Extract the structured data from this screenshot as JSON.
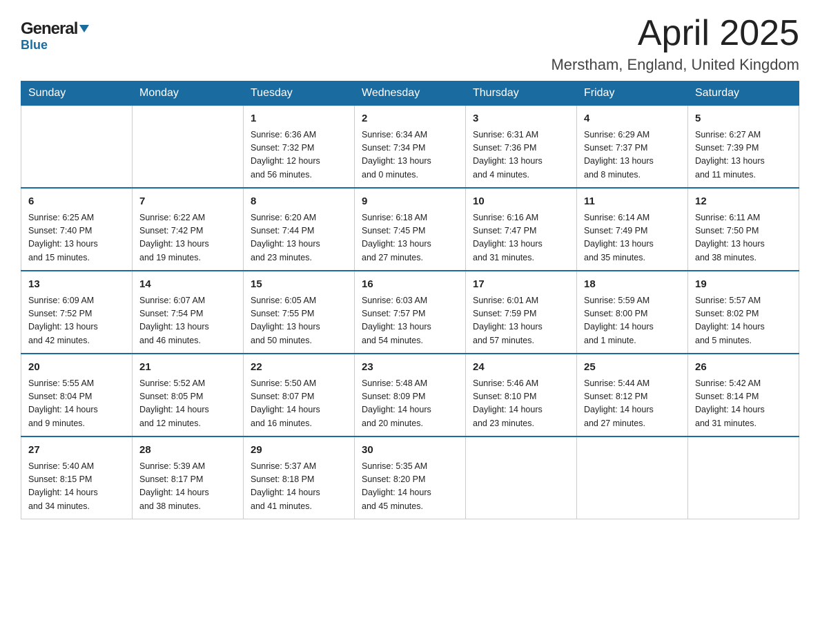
{
  "header": {
    "title": "April 2025",
    "subtitle": "Merstham, England, United Kingdom",
    "logo_general": "General",
    "logo_blue": "Blue"
  },
  "days_of_week": [
    "Sunday",
    "Monday",
    "Tuesday",
    "Wednesday",
    "Thursday",
    "Friday",
    "Saturday"
  ],
  "weeks": [
    [
      {
        "day": "",
        "info": ""
      },
      {
        "day": "",
        "info": ""
      },
      {
        "day": "1",
        "info": "Sunrise: 6:36 AM\nSunset: 7:32 PM\nDaylight: 12 hours\nand 56 minutes."
      },
      {
        "day": "2",
        "info": "Sunrise: 6:34 AM\nSunset: 7:34 PM\nDaylight: 13 hours\nand 0 minutes."
      },
      {
        "day": "3",
        "info": "Sunrise: 6:31 AM\nSunset: 7:36 PM\nDaylight: 13 hours\nand 4 minutes."
      },
      {
        "day": "4",
        "info": "Sunrise: 6:29 AM\nSunset: 7:37 PM\nDaylight: 13 hours\nand 8 minutes."
      },
      {
        "day": "5",
        "info": "Sunrise: 6:27 AM\nSunset: 7:39 PM\nDaylight: 13 hours\nand 11 minutes."
      }
    ],
    [
      {
        "day": "6",
        "info": "Sunrise: 6:25 AM\nSunset: 7:40 PM\nDaylight: 13 hours\nand 15 minutes."
      },
      {
        "day": "7",
        "info": "Sunrise: 6:22 AM\nSunset: 7:42 PM\nDaylight: 13 hours\nand 19 minutes."
      },
      {
        "day": "8",
        "info": "Sunrise: 6:20 AM\nSunset: 7:44 PM\nDaylight: 13 hours\nand 23 minutes."
      },
      {
        "day": "9",
        "info": "Sunrise: 6:18 AM\nSunset: 7:45 PM\nDaylight: 13 hours\nand 27 minutes."
      },
      {
        "day": "10",
        "info": "Sunrise: 6:16 AM\nSunset: 7:47 PM\nDaylight: 13 hours\nand 31 minutes."
      },
      {
        "day": "11",
        "info": "Sunrise: 6:14 AM\nSunset: 7:49 PM\nDaylight: 13 hours\nand 35 minutes."
      },
      {
        "day": "12",
        "info": "Sunrise: 6:11 AM\nSunset: 7:50 PM\nDaylight: 13 hours\nand 38 minutes."
      }
    ],
    [
      {
        "day": "13",
        "info": "Sunrise: 6:09 AM\nSunset: 7:52 PM\nDaylight: 13 hours\nand 42 minutes."
      },
      {
        "day": "14",
        "info": "Sunrise: 6:07 AM\nSunset: 7:54 PM\nDaylight: 13 hours\nand 46 minutes."
      },
      {
        "day": "15",
        "info": "Sunrise: 6:05 AM\nSunset: 7:55 PM\nDaylight: 13 hours\nand 50 minutes."
      },
      {
        "day": "16",
        "info": "Sunrise: 6:03 AM\nSunset: 7:57 PM\nDaylight: 13 hours\nand 54 minutes."
      },
      {
        "day": "17",
        "info": "Sunrise: 6:01 AM\nSunset: 7:59 PM\nDaylight: 13 hours\nand 57 minutes."
      },
      {
        "day": "18",
        "info": "Sunrise: 5:59 AM\nSunset: 8:00 PM\nDaylight: 14 hours\nand 1 minute."
      },
      {
        "day": "19",
        "info": "Sunrise: 5:57 AM\nSunset: 8:02 PM\nDaylight: 14 hours\nand 5 minutes."
      }
    ],
    [
      {
        "day": "20",
        "info": "Sunrise: 5:55 AM\nSunset: 8:04 PM\nDaylight: 14 hours\nand 9 minutes."
      },
      {
        "day": "21",
        "info": "Sunrise: 5:52 AM\nSunset: 8:05 PM\nDaylight: 14 hours\nand 12 minutes."
      },
      {
        "day": "22",
        "info": "Sunrise: 5:50 AM\nSunset: 8:07 PM\nDaylight: 14 hours\nand 16 minutes."
      },
      {
        "day": "23",
        "info": "Sunrise: 5:48 AM\nSunset: 8:09 PM\nDaylight: 14 hours\nand 20 minutes."
      },
      {
        "day": "24",
        "info": "Sunrise: 5:46 AM\nSunset: 8:10 PM\nDaylight: 14 hours\nand 23 minutes."
      },
      {
        "day": "25",
        "info": "Sunrise: 5:44 AM\nSunset: 8:12 PM\nDaylight: 14 hours\nand 27 minutes."
      },
      {
        "day": "26",
        "info": "Sunrise: 5:42 AM\nSunset: 8:14 PM\nDaylight: 14 hours\nand 31 minutes."
      }
    ],
    [
      {
        "day": "27",
        "info": "Sunrise: 5:40 AM\nSunset: 8:15 PM\nDaylight: 14 hours\nand 34 minutes."
      },
      {
        "day": "28",
        "info": "Sunrise: 5:39 AM\nSunset: 8:17 PM\nDaylight: 14 hours\nand 38 minutes."
      },
      {
        "day": "29",
        "info": "Sunrise: 5:37 AM\nSunset: 8:18 PM\nDaylight: 14 hours\nand 41 minutes."
      },
      {
        "day": "30",
        "info": "Sunrise: 5:35 AM\nSunset: 8:20 PM\nDaylight: 14 hours\nand 45 minutes."
      },
      {
        "day": "",
        "info": ""
      },
      {
        "day": "",
        "info": ""
      },
      {
        "day": "",
        "info": ""
      }
    ]
  ]
}
